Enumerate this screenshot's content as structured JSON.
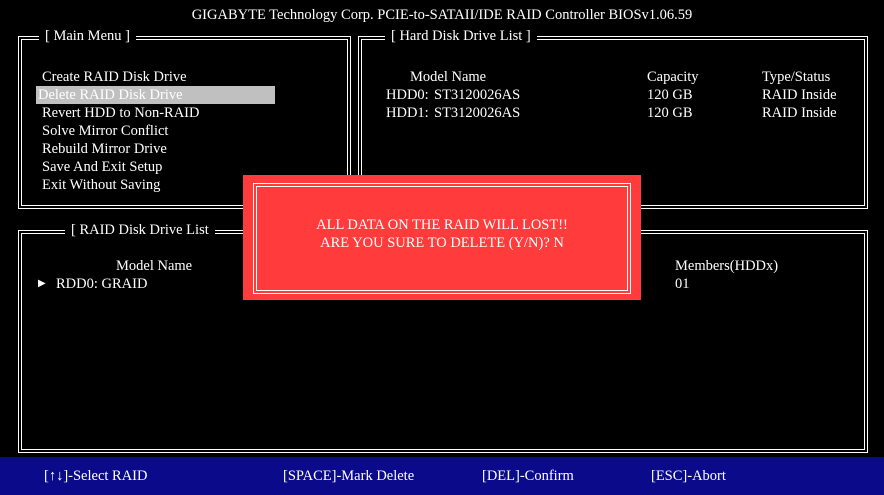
{
  "title": "GIGABYTE Technology Corp. PCIE-to-SATAII/IDE RAID Controller BIOSv1.06.59",
  "main_menu": {
    "title": "[ Main Menu ]",
    "items": [
      "Create RAID Disk Drive",
      "Delete RAID Disk Drive",
      "Revert HDD to Non-RAID",
      "Solve Mirror Conflict",
      "Rebuild Mirror Drive",
      "Save And Exit Setup",
      "Exit Without Saving"
    ],
    "selected_index": 1
  },
  "hdd_list": {
    "title": "[ Hard Disk Drive List ]",
    "headers": {
      "model": "Model Name",
      "capacity": "Capacity",
      "status": "Type/Status"
    },
    "rows": [
      {
        "id": "HDD0:",
        "model": "ST3120026AS",
        "capacity": "120 GB",
        "status": "RAID Inside"
      },
      {
        "id": "HDD1:",
        "model": "ST3120026AS",
        "capacity": "120 GB",
        "status": "RAID Inside"
      }
    ]
  },
  "raid_list": {
    "title": "[ RAID Disk Drive List",
    "headers": {
      "model": "Model Name",
      "members": "Members(HDDx)"
    },
    "rows": [
      {
        "marker": "▶",
        "name": "RDD0: GRAID",
        "members": "01"
      }
    ]
  },
  "dialog": {
    "line1": "ALL DATA ON THE RAID WILL LOST!!",
    "line2": "ARE YOU SURE TO DELETE (Y/N)? N"
  },
  "footer": {
    "select": "[↑↓]-Select RAID",
    "mark": "[SPACE]-Mark Delete",
    "confirm": "[DEL]-Confirm",
    "abort": "[ESC]-Abort"
  },
  "colors": {
    "background": "#000000",
    "dialog": "#ff3b3b",
    "footer": "#0a0a8a",
    "highlight": "#c0c0c0"
  }
}
